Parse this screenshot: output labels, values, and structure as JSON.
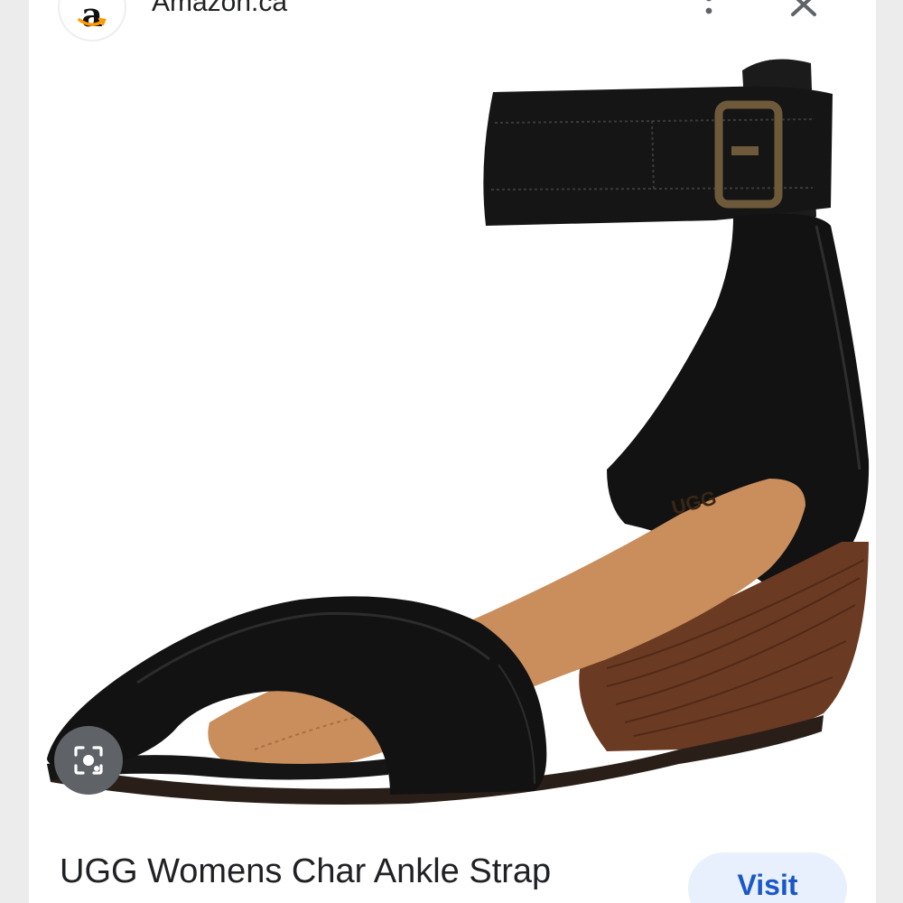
{
  "header": {
    "favicon_letter": "a",
    "site_name": "Amazon.ca",
    "icons": {
      "more": "more-vert-icon",
      "close": "close-icon",
      "favicon": "amazon-logo-icon"
    }
  },
  "image": {
    "description_icon": "lens-icon",
    "logo_text": "UGG"
  },
  "footer": {
    "title": "UGG Womens Char Ankle Strap",
    "visit_label": "Visit"
  },
  "colors": {
    "background": "#e9e9ea",
    "card": "#ffffff",
    "visit_bg": "#e8f0fe",
    "visit_text": "#1a57c8",
    "lens_bg": "#5f6368",
    "sandal_leather": "#141414",
    "footbed": "#c98e5c",
    "wedge": "#6b3a22",
    "brand_orange": "#ff9900"
  }
}
